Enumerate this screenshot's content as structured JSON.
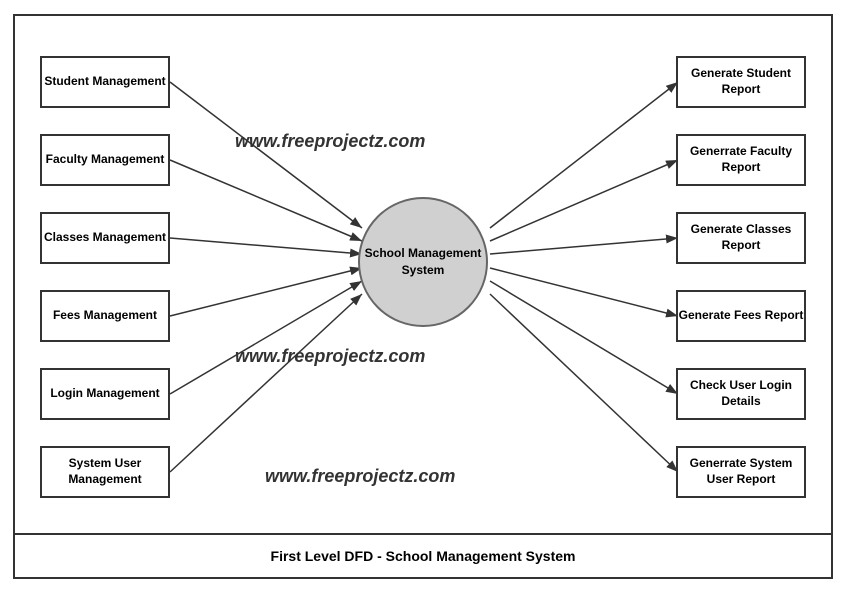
{
  "diagram": {
    "title": "First Level DFD - School Management System",
    "center": {
      "label": "School\nManagement\nSystem"
    },
    "watermarks": [
      "www.freeprojectz.com",
      "www.freeprojectz.com",
      "www.freeprojectz.com"
    ],
    "left_boxes": [
      {
        "id": "student-mgmt",
        "label": "Student\nManagement"
      },
      {
        "id": "faculty-mgmt",
        "label": "Faculty\nManagement"
      },
      {
        "id": "classes-mgmt",
        "label": "Classes\nManagement"
      },
      {
        "id": "fees-mgmt",
        "label": "Fees\nManagement"
      },
      {
        "id": "login-mgmt",
        "label": "Login\nManagement"
      },
      {
        "id": "sysuser-mgmt",
        "label": "System User\nManagement"
      }
    ],
    "right_boxes": [
      {
        "id": "gen-student",
        "label": "Generate\nStudent Report"
      },
      {
        "id": "gen-faculty",
        "label": "Generrate\nFaculty Report"
      },
      {
        "id": "gen-classes",
        "label": "Generate\nClasses Report"
      },
      {
        "id": "gen-fees",
        "label": "Generate\nFees Report"
      },
      {
        "id": "check-login",
        "label": "Check\nUser Login Details"
      },
      {
        "id": "gen-sysuser",
        "label": "Generrate\nSystem User Report"
      }
    ]
  }
}
